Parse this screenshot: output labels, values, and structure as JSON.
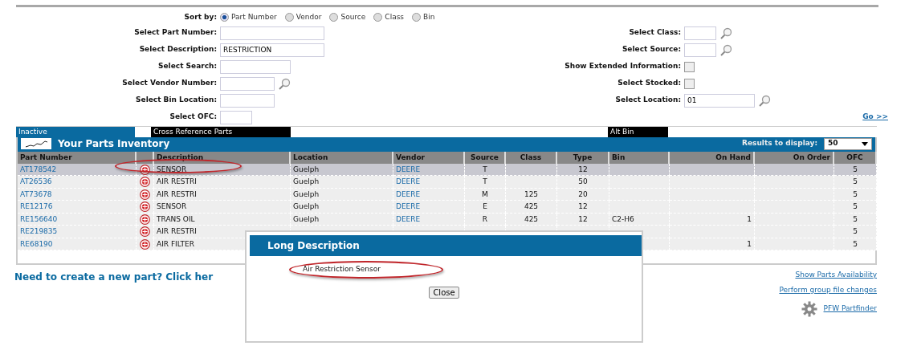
{
  "sort": {
    "label": "Sort by:",
    "options": [
      {
        "label": "Part Number",
        "selected": true
      },
      {
        "label": "Vendor",
        "selected": false
      },
      {
        "label": "Source",
        "selected": false
      },
      {
        "label": "Class",
        "selected": false
      },
      {
        "label": "Bin",
        "selected": false
      }
    ]
  },
  "filters_left": [
    {
      "label": "Select Part Number:",
      "kind": "text",
      "lookup": false
    },
    {
      "label": "Select Description:",
      "kind": "text",
      "value": "RESTRICTION",
      "lookup": false
    },
    {
      "label": "Select Search:",
      "kind": "text",
      "lookup": false
    },
    {
      "label": "Select Vendor Number:",
      "kind": "text",
      "lookup": true
    },
    {
      "label": "Select Bin Location:",
      "kind": "text",
      "lookup": false
    },
    {
      "label": "Select OFC:",
      "kind": "text",
      "lookup": false
    }
  ],
  "filters_right": [
    {
      "label": "Select Class:",
      "kind": "text",
      "lookup": true
    },
    {
      "label": "Select Source:",
      "kind": "text",
      "lookup": true
    },
    {
      "label": "Show Extended Information:",
      "kind": "checkbox",
      "checked": false
    },
    {
      "label": "Select Stocked:",
      "kind": "checkbox",
      "checked": false
    },
    {
      "label": "Select Location:",
      "kind": "text",
      "value": "01",
      "lookup": true
    }
  ],
  "go_link": "Go >>",
  "legend": [
    {
      "label": "Inactive",
      "kind": "inactive"
    },
    {
      "kind": "blank"
    },
    {
      "label": "Cross Reference Parts",
      "kind": "cross_reference"
    },
    {
      "kind": "blank"
    },
    {
      "label": "Alt Bin",
      "kind": "alt_bin"
    },
    {
      "kind": "blank"
    }
  ],
  "inventory": {
    "title": "Your Parts Inventory",
    "results_label": "Results to display:",
    "results_value": "50",
    "columns": [
      "Part Number",
      "Description",
      "Location",
      "Vendor",
      "Source",
      "Class",
      "Type",
      "Bin",
      "On Hand",
      "On Order",
      "OFC"
    ],
    "rows": [
      {
        "selected": true,
        "cells": [
          "AT178542",
          "SENSOR",
          "Guelph",
          "DEERE",
          "T",
          null,
          "12",
          null,
          null,
          null,
          "5"
        ]
      },
      {
        "selected": false,
        "cells": [
          "AT26536",
          "AIR RESTRI",
          "Guelph",
          "DEERE",
          "T",
          null,
          "50",
          null,
          null,
          null,
          "5"
        ]
      },
      {
        "selected": false,
        "cells": [
          "AT73678",
          "AIR RESTRI",
          "Guelph",
          "DEERE",
          "M",
          "125",
          "20",
          null,
          null,
          null,
          "5"
        ]
      },
      {
        "selected": false,
        "cells": [
          "RE12176",
          "SENSOR",
          "Guelph",
          "DEERE",
          "E",
          "425",
          "12",
          null,
          null,
          null,
          "5"
        ]
      },
      {
        "selected": false,
        "cells": [
          "RE156640",
          "TRANS OIL",
          "Guelph",
          "DEERE",
          "R",
          "425",
          "12",
          "C2-H6",
          "1",
          null,
          "5"
        ]
      },
      {
        "selected": false,
        "cells": [
          "RE219835",
          "AIR RESTRI",
          null,
          null,
          null,
          null,
          null,
          null,
          null,
          null,
          "5"
        ]
      },
      {
        "selected": false,
        "cells": [
          "RE68190",
          "AIR FILTER",
          null,
          null,
          null,
          null,
          null,
          null,
          "1",
          null,
          "5"
        ]
      }
    ]
  },
  "create_prompt": "Need to create a new part? Click her",
  "links": [
    "Show Parts Availability",
    "Perform group file changes",
    "PFW Partfinder"
  ],
  "dialog": {
    "title": "Long Description",
    "text": "Air Restriction Sensor",
    "button": "Close"
  }
}
